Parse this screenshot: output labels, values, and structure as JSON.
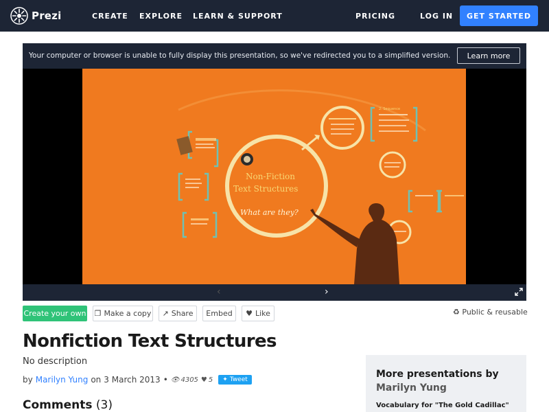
{
  "nav": {
    "logo": "Prezi",
    "links": [
      "CREATE",
      "EXPLORE",
      "LEARN & SUPPORT"
    ],
    "pricing": "PRICING",
    "login": "LOG IN",
    "cta": "GET STARTED"
  },
  "notice": {
    "text": "Your computer or browser is unable to fully display this presentation, so we've redirected you to a simplified version.",
    "button": "Learn more"
  },
  "slide": {
    "title_line1": "Non-Fiction",
    "title_line2": "Text Structures",
    "subtitle": "What are they?",
    "sequence_label": "2. Sequence"
  },
  "actions": {
    "create": "Create your own",
    "copy": "Make a copy",
    "share": "Share",
    "embed": "Embed",
    "like": "Like",
    "public": "Public & reusable"
  },
  "presentation": {
    "title": "Nonfiction Text Structures",
    "description": "No description",
    "by": "by",
    "author": "Marilyn Yung",
    "date_prefix": "on",
    "date": "3 March 2013",
    "views": "4305",
    "likes": "5",
    "tweet": "Tweet"
  },
  "comments": {
    "label": "Comments",
    "count": "(3)"
  },
  "more": {
    "heading": "More presentations by",
    "author": "Marilyn Yung",
    "first_item": "Vocabulary for \"The Gold Cadillac\""
  },
  "colors": {
    "nav_bg": "#1d2535",
    "accent": "#3181ff",
    "green": "#2fc378",
    "slide_bg": "#f07a1f"
  }
}
